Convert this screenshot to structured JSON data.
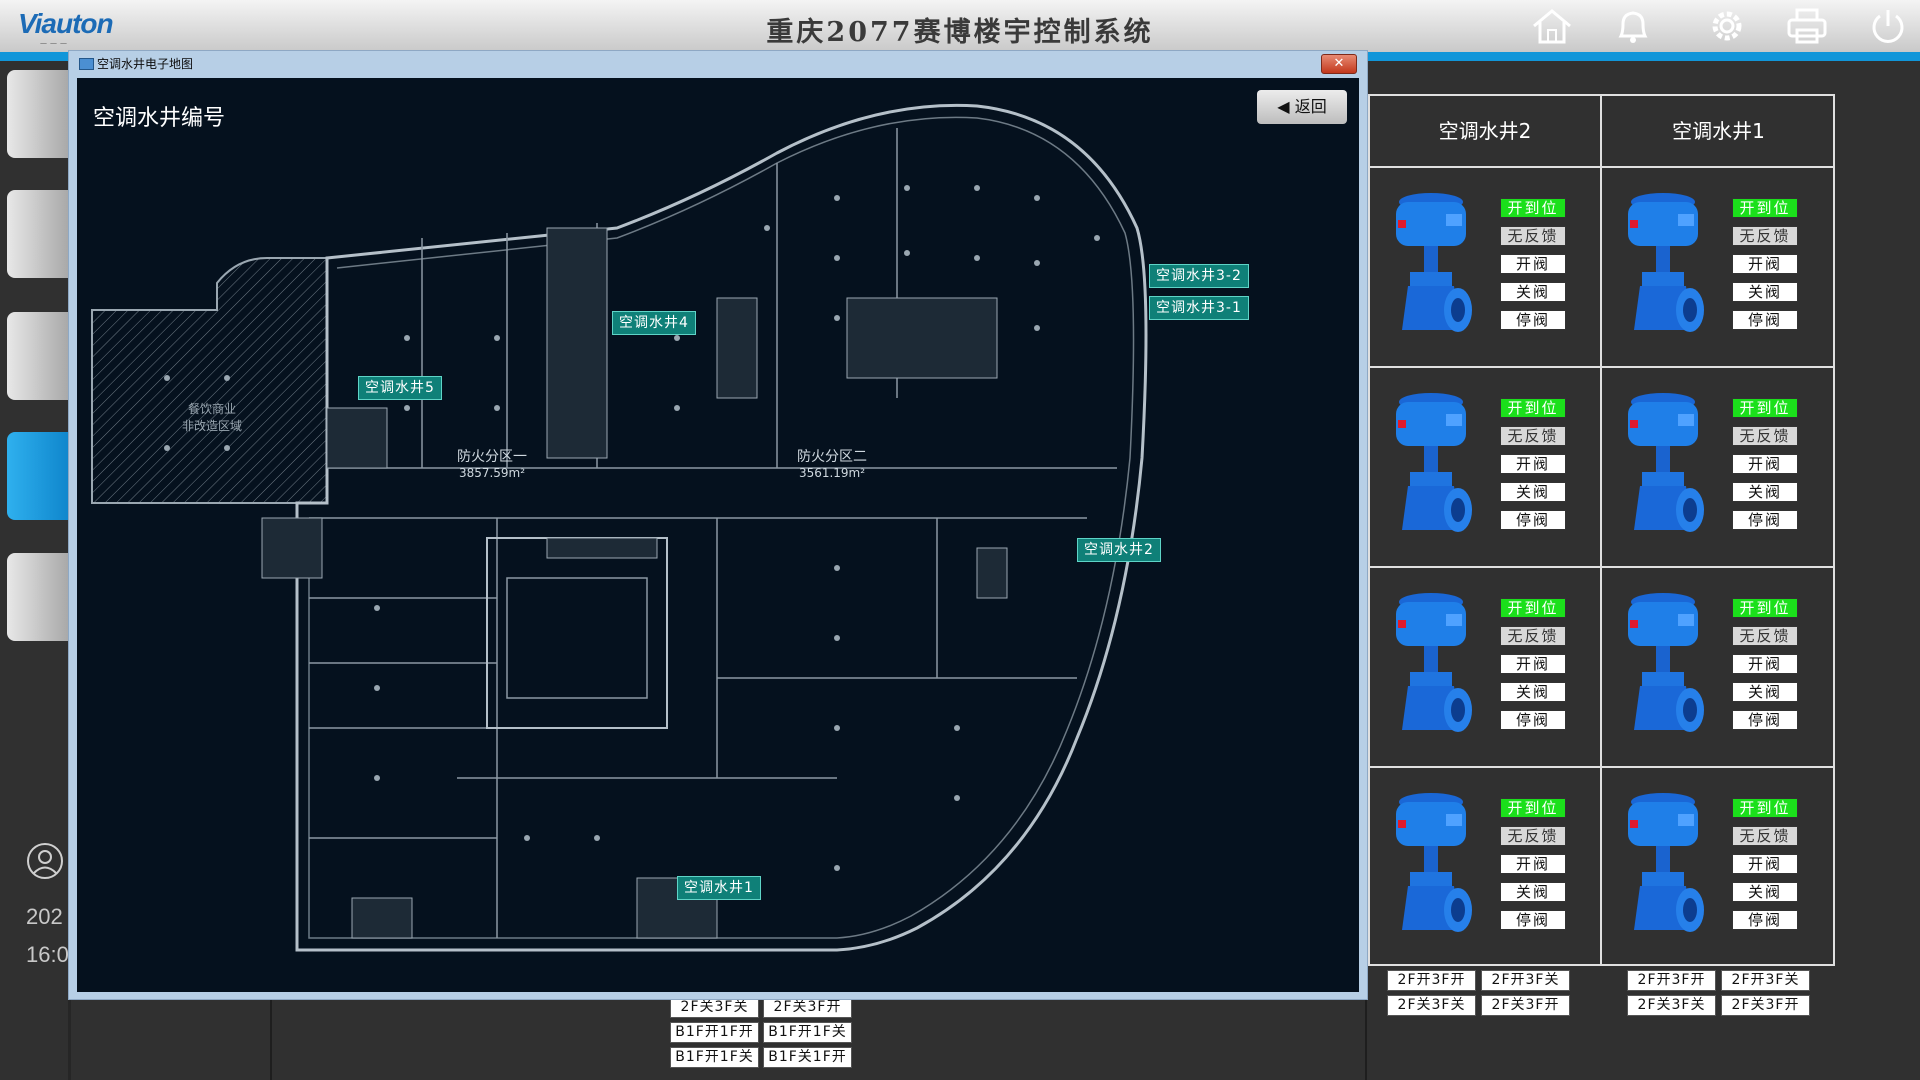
{
  "header": {
    "logo_text": "Viauton",
    "title": "重庆2077赛博楼宇控制系统",
    "icons": [
      "home-icon",
      "bell-icon",
      "gear-icon",
      "printer-icon",
      "power-icon"
    ]
  },
  "left": {
    "date_fragment": "202",
    "time_fragment": "16:0"
  },
  "dialog": {
    "title": "空调水井电子地图",
    "close_label": "✕",
    "map_title": "空调水井编号",
    "back_label": "返回",
    "zone_1_name": "防火分区一",
    "zone_1_area": "3857.59m²",
    "zone_2_name": "防火分区二",
    "zone_2_area": "3561.19m²",
    "zone_note_1": "餐饮商业",
    "zone_note_2": "非改造区域",
    "tags": {
      "well1": "空调水井1",
      "well2": "空调水井2",
      "well3_1": "空调水井3-1",
      "well3_2": "空调水井3-2",
      "well4": "空调水井4",
      "well5": "空调水井5"
    }
  },
  "wells_panel": {
    "columns": [
      "空调水井2",
      "空调水井1"
    ],
    "valve_buttons": {
      "status_open": "开到位",
      "status_feedback": "无反馈",
      "open": "开阀",
      "close": "关阀",
      "stop": "停阀"
    },
    "bottom_buttons": {
      "col1": [
        "2F开3F开",
        "2F开3F关",
        "2F关3F关",
        "2F关3F开"
      ],
      "col2": [
        "2F开3F开",
        "2F开3F关",
        "2F关3F关",
        "2F关3F开"
      ],
      "center": [
        "2F关3F关",
        "2F关3F开",
        "B1F开1F开",
        "B1F开1F关",
        "B1F开1F关",
        "B1F关1F开"
      ]
    }
  }
}
